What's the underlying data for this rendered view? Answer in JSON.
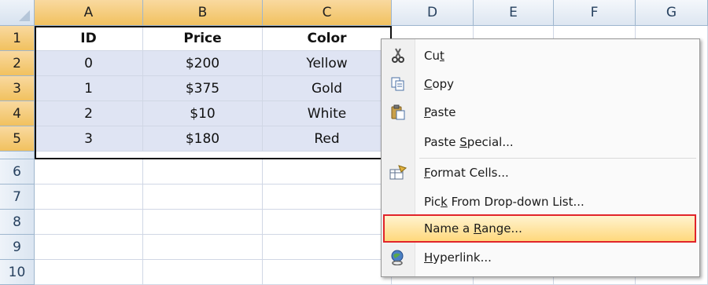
{
  "columns": [
    "A",
    "B",
    "C",
    "D",
    "E",
    "F",
    "G"
  ],
  "rows": [
    "1",
    "2",
    "3",
    "4",
    "5",
    "6",
    "7",
    "8",
    "9",
    "10"
  ],
  "table": {
    "headers": [
      "ID",
      "Price",
      "Color"
    ],
    "data": [
      [
        "0",
        "$200",
        "Yellow"
      ],
      [
        "1",
        "$375",
        "Gold"
      ],
      [
        "2",
        "$10",
        "White"
      ],
      [
        "3",
        "$180",
        "Red"
      ]
    ]
  },
  "menu": {
    "cut": {
      "pre": "Cu",
      "key": "t",
      "post": ""
    },
    "copy": {
      "pre": "",
      "key": "C",
      "post": "opy"
    },
    "paste": {
      "pre": "",
      "key": "P",
      "post": "aste"
    },
    "paste_special": {
      "pre": "Paste ",
      "key": "S",
      "post": "pecial..."
    },
    "format_cells": {
      "pre": "",
      "key": "F",
      "post": "ormat Cells..."
    },
    "pick_list": {
      "pre": "Pic",
      "key": "k",
      "post": " From Drop-down List..."
    },
    "name_range": {
      "pre": "Name a ",
      "key": "R",
      "post": "ange..."
    },
    "hyperlink": {
      "pre": "",
      "key": "H",
      "post": "yperlink..."
    },
    "highlight_color": "#e1242a"
  },
  "icons": {
    "cut": "scissors-icon",
    "copy": "copy-icon",
    "paste": "paste-icon",
    "format_cells": "format-cells-icon",
    "hyperlink": "hyperlink-icon"
  }
}
